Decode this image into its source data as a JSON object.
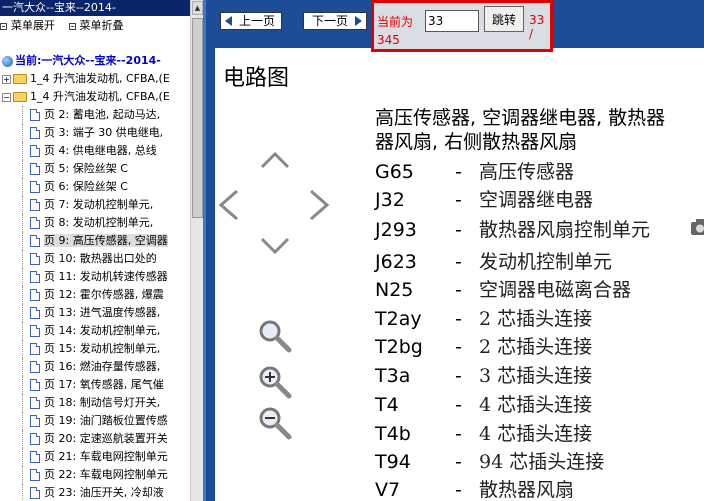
{
  "left": {
    "title": "一汽大众--宝来--2014-",
    "menu_expand": "菜单展开",
    "menu_collapse": "菜单折叠",
    "current": "当前:一汽大众--宝来--2014-",
    "nodes": [
      {
        "label": "1_4 升汽油发动机, CFBA,(E",
        "pm": "+"
      },
      {
        "label": "1_4 升汽油发动机, CFBA,(E",
        "pm": "−"
      }
    ],
    "pages": [
      "页 2: 蓄电池, 起动马达,",
      "页 3: 端子 30 供电继电,",
      "页 4: 供电继电器, 总线",
      "页 5: 保险丝架 C",
      "页 6: 保险丝架 C",
      "页 7: 发动机控制单元,",
      "页 8: 发动机控制单元,",
      "页 9: 高压传感器, 空调器",
      "页 10: 散热器出口处的",
      "页 11: 发动机转速传感器",
      "页 12: 霍尔传感器, 爆震",
      "页 13: 进气温度传感器,",
      "页 14: 发动机控制单元,",
      "页 15: 发动机控制单元,",
      "页 16: 燃油存量传感器,",
      "页 17: 氧传感器, 尾气催",
      "页 18: 制动信号灯开关,",
      "页 19: 油门踏板位置传感",
      "页 20: 定速巡航装置开关",
      "页 21: 车载电网控制单元",
      "页 22: 车载电网控制单元",
      "页 23: 油压开关, 冷却液"
    ],
    "selected_index": 7
  },
  "toolbar": {
    "prev_label": "上一页",
    "next_label": "下一页",
    "current_label": "当前为",
    "page_value": "33",
    "jump_label": "跳转",
    "total_a": "33 /",
    "total_b": "345"
  },
  "doc": {
    "title": "电路图",
    "desc_line1": "高压传感器, 空调器继电器, 散热器",
    "desc_line2": "器风扇, 右侧散热器风扇",
    "legend": [
      {
        "code": "G65",
        "dash": "-",
        "text": "高压传感器"
      },
      {
        "code": "J32",
        "dash": "-",
        "text": "空调器继电器"
      },
      {
        "code": "J293",
        "dash": "-",
        "text": "散热器风扇控制单元"
      },
      {
        "code": "J623",
        "dash": "-",
        "text": "发动机控制单元"
      },
      {
        "code": "N25",
        "dash": "-",
        "text": "空调器电磁离合器"
      },
      {
        "code": "T2ay",
        "dash": "-",
        "text": "2 芯插头连接"
      },
      {
        "code": "T2bg",
        "dash": "-",
        "text": "2 芯插头连接"
      },
      {
        "code": "T3a",
        "dash": "-",
        "text": "3 芯插头连接"
      },
      {
        "code": "T4",
        "dash": "-",
        "text": "4 芯插头连接"
      },
      {
        "code": "T4b",
        "dash": "-",
        "text": "4 芯插头连接"
      },
      {
        "code": "T94",
        "dash": "-",
        "text": "94 芯插头连接"
      },
      {
        "code": "V7",
        "dash": "-",
        "text": "散热器风扇"
      }
    ]
  },
  "icons": {
    "up": "chevron-up-icon",
    "down": "chevron-down-icon",
    "left": "chevron-left-icon",
    "right": "chevron-right-icon",
    "zoom": "magnifier-icon",
    "zoom_in": "zoom-in-icon",
    "zoom_out": "zoom-out-icon",
    "camera": "camera-icon"
  },
  "colors": {
    "toolbar_bg": "#1e4d97",
    "highlight_border": "#e00000",
    "label_red": "#d00000"
  }
}
